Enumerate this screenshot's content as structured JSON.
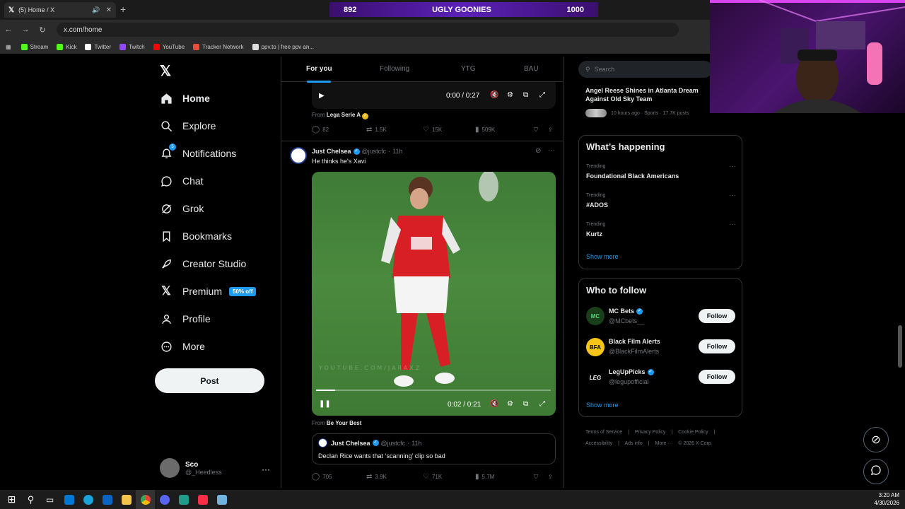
{
  "browser": {
    "tab_title": "(5) Home / X",
    "url": "x.com/home",
    "bookmarks": [
      {
        "label": "Stream",
        "color": "#53fc18"
      },
      {
        "label": "Kick",
        "color": "#53fc18"
      },
      {
        "label": "Twitter",
        "color": "#ffffff"
      },
      {
        "label": "Twitch",
        "color": "#9146ff"
      },
      {
        "label": "YouTube",
        "color": "#ff0000"
      },
      {
        "label": "Tracker Network",
        "color": "#e74c3c"
      },
      {
        "label": "ppv.to | free ppv an...",
        "color": "#ffffff"
      }
    ]
  },
  "overlay": {
    "left": "892",
    "title": "UGLY GOONIES",
    "right": "1000"
  },
  "nav": {
    "items": [
      {
        "label": "Home",
        "icon": "home-icon"
      },
      {
        "label": "Explore",
        "icon": "search-icon"
      },
      {
        "label": "Notifications",
        "icon": "bell-icon"
      },
      {
        "label": "Chat",
        "icon": "chat-icon"
      },
      {
        "label": "Grok",
        "icon": "grok-icon"
      },
      {
        "label": "Bookmarks",
        "icon": "bookmark-icon"
      },
      {
        "label": "Creator Studio",
        "icon": "rocket-icon"
      },
      {
        "label": "Premium",
        "icon": "x-icon"
      },
      {
        "label": "Profile",
        "icon": "person-icon"
      },
      {
        "label": "More",
        "icon": "more-circle-icon"
      }
    ],
    "premium_badge": "50% off",
    "notification_count": "5",
    "post_label": "Post",
    "account": {
      "name": "Sco",
      "handle": "@_Heedless"
    }
  },
  "feed": {
    "tabs": [
      "For you",
      "Following",
      "YTG",
      "BAU"
    ],
    "post1": {
      "video_time": "0:00 / 0:27",
      "from_label": "From",
      "from_source": "Lega Serie A",
      "replies": "82",
      "reposts": "1.5K",
      "likes": "15K",
      "views": "509K"
    },
    "post2": {
      "author": "Just Chelsea",
      "handle": "@justcfc",
      "time": "11h",
      "text": "He thinks he's Xavi",
      "video_time": "0:02 / 0:21",
      "video_progress": 0.08,
      "watermark": "YOUTUBE.COM/JARAXZ",
      "from_label": "From",
      "from_source": "Be Your Best",
      "quote": {
        "author": "Just Chelsea",
        "handle": "@justcfc",
        "time": "11h",
        "text": "Declan Rice wants that ‘scanning’ clip so bad"
      },
      "replies": "705",
      "reposts": "3.9K",
      "likes": "71K",
      "views": "5.7M"
    }
  },
  "right": {
    "search_placeholder": "Search",
    "top_trend": {
      "title": "Angel Reese Shines in Atlanta Dream Against Old Sky Team",
      "meta": "10 hours ago · Sports · 17.7K posts"
    },
    "whats_happening": {
      "title": "What’s happening",
      "trends": [
        {
          "label": "Trending",
          "name": "Foundational Black Americans"
        },
        {
          "label": "Trending",
          "name": "#ADOS"
        },
        {
          "label": "Trending",
          "name": "Kurtz"
        }
      ],
      "show_more": "Show more"
    },
    "who_to_follow": {
      "title": "Who to follow",
      "accounts": [
        {
          "name": "MC Bets",
          "handle": "@MCbets__",
          "initials": "MC"
        },
        {
          "name": "Black Film Alerts",
          "handle": "@BlackFilmAlerts",
          "initials": "BFA"
        },
        {
          "name": "LegUpPicks",
          "handle": "@legupofficial",
          "initials": "LEG"
        }
      ],
      "follow_label": "Follow",
      "show_more": "Show more"
    },
    "footer": [
      "Terms of Service",
      "|",
      "Privacy Policy",
      "|",
      "Cookie Policy",
      "|",
      "Accessibility",
      "|",
      "Ads info",
      "|",
      "More ···",
      "© 2026 X Corp."
    ]
  },
  "taskbar": {
    "time": "3:20 AM",
    "date": "4/30/2026"
  }
}
